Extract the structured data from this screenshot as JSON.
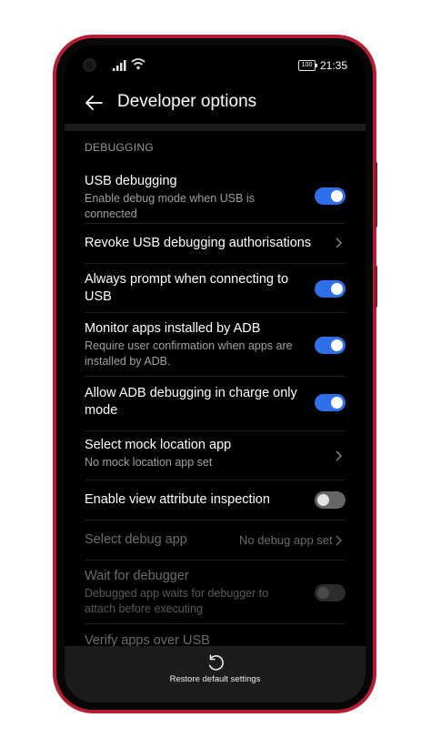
{
  "status_bar": {
    "battery": "100",
    "time": "21:35"
  },
  "header": {
    "title": "Developer options"
  },
  "section": {
    "label": "DEBUGGING"
  },
  "items": [
    {
      "title": "USB debugging",
      "subtitle": "Enable debug mode when USB is connected",
      "control": "toggle",
      "state": "on"
    },
    {
      "title": "Revoke USB debugging authorisations",
      "control": "chevron"
    },
    {
      "title": "Always prompt when connecting to USB",
      "control": "toggle",
      "state": "on"
    },
    {
      "title": "Monitor apps installed by ADB",
      "subtitle": "Require user confirmation when apps are installed by ADB.",
      "control": "toggle",
      "state": "on"
    },
    {
      "title": "Allow ADB debugging in charge only mode",
      "control": "toggle",
      "state": "on"
    },
    {
      "title": "Select mock location app",
      "subtitle": "No mock location app set",
      "control": "chevron"
    },
    {
      "title": "Enable view attribute inspection",
      "control": "toggle",
      "state": "off"
    },
    {
      "title": "Select debug app",
      "value": "No debug app set",
      "control": "chevron",
      "disabled": true
    },
    {
      "title": "Wait for debugger",
      "subtitle": "Debugged app waits for debugger to attach before executing",
      "control": "toggle",
      "state": "off",
      "disabled": true
    },
    {
      "title": "Verify apps over USB",
      "disabled": true
    }
  ],
  "bottom_bar": {
    "label": "Restore default settings",
    "icon": "restore-icon"
  },
  "colors": {
    "accent": "#2f6fe9",
    "frame": "#b31e34",
    "background": "#000000"
  }
}
